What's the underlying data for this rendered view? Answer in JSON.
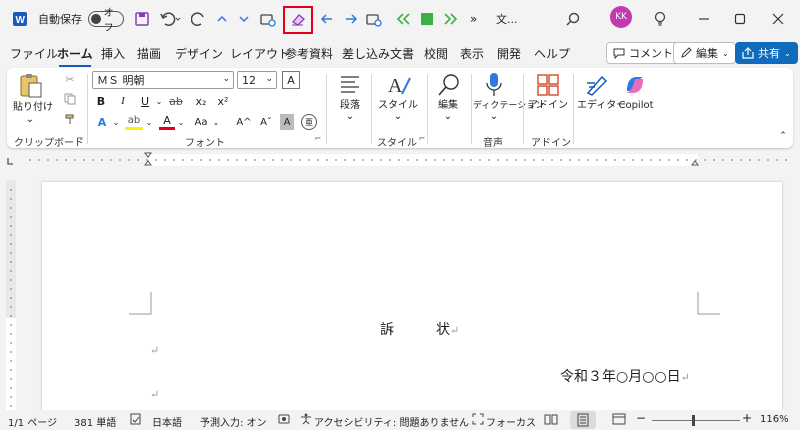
{
  "title_bar": {
    "autosave_label": "自動保存",
    "autosave_state": "オフ",
    "doc_title": "文...",
    "avatar_initials": "KK",
    "more_label": "»"
  },
  "tabs": [
    "ファイル",
    "ホーム",
    "挿入",
    "描画",
    "デザイン",
    "レイアウト",
    "参考資料",
    "差し込み文書",
    "校閲",
    "表示",
    "開発",
    "ヘルプ"
  ],
  "active_tab": "ホーム",
  "actions": {
    "comment": "コメント",
    "edit": "編集",
    "share": "共有"
  },
  "ribbon": {
    "clipboard": {
      "paste": "貼り付け",
      "label": "クリップボード"
    },
    "font": {
      "name": "ＭＳ 明朝",
      "size": "12",
      "label": "フォント",
      "bold": "B",
      "italic": "I",
      "underline": "U",
      "strike": "ab",
      "sub": "x₂",
      "sup": "x²",
      "effects": "A",
      "highlight": "ab",
      "color": "A",
      "case": "Aa",
      "grow": "A^",
      "shrink": "Aˇ",
      "shade": "A",
      "phonetic": "亜"
    },
    "paragraph": {
      "label": "段落"
    },
    "styles": {
      "label": "スタイル",
      "button": "スタイル"
    },
    "editing": {
      "label": "編集"
    },
    "voice": {
      "dictation": "ディクテーション",
      "group": "音声"
    },
    "addins": {
      "button": "アドイン",
      "group": "アドイン"
    },
    "editor": {
      "button": "エディター"
    },
    "copilot": {
      "button": "Copilot"
    }
  },
  "document": {
    "title": "訴　　　状",
    "date": "令和３年○月○○日"
  },
  "status": {
    "page": "1/1 ページ",
    "words": "381 単語",
    "language": "日本語",
    "predict": "予測入力: オン",
    "accessibility": "アクセシビリティ: 問題ありません",
    "focus": "フォーカス",
    "zoom": "116%"
  },
  "colors": {
    "accent": "#185abd",
    "highlight_box": "#e3001b",
    "avatar": "#c239b3",
    "share": "#0f6cbd"
  }
}
